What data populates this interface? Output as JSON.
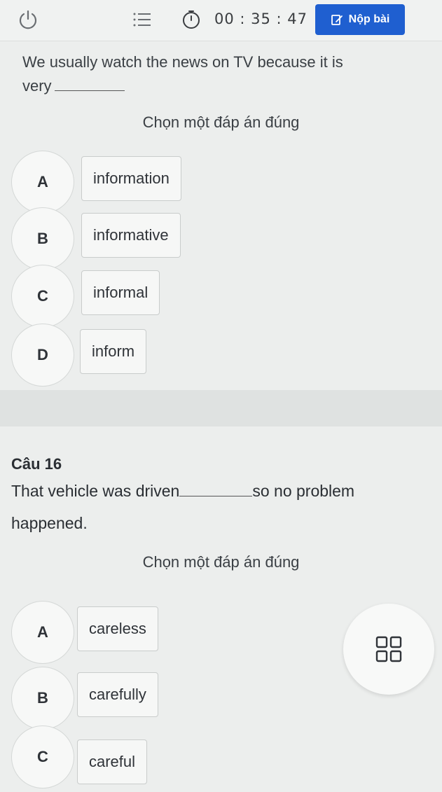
{
  "header": {
    "timer": "00 : 35 : 47",
    "submit_label": "Nộp bài",
    "icons": [
      "power-icon",
      "menu-icon",
      "timer-icon",
      "submit-icon"
    ],
    "accent_color": "#1f5fd0"
  },
  "question_prev": {
    "line1": "We usually watch the news on TV because it is",
    "line2_prefix": "very",
    "prompt": "Chọn một đáp án đúng",
    "options": [
      {
        "letter": "A",
        "text": "information"
      },
      {
        "letter": "B",
        "text": "informative"
      },
      {
        "letter": "C",
        "text": "informal"
      },
      {
        "letter": "D",
        "text": "inform"
      }
    ]
  },
  "question_16": {
    "number": "Câu 16",
    "text_before": "That vehicle was driven",
    "text_after": "so no problem happened.",
    "prompt": "Chọn một đáp án đúng",
    "options": [
      {
        "letter": "A",
        "text": "careless"
      },
      {
        "letter": "B",
        "text": "carefully"
      },
      {
        "letter": "C",
        "text": "careful"
      }
    ]
  },
  "fab": {
    "icon": "grid-icon"
  }
}
